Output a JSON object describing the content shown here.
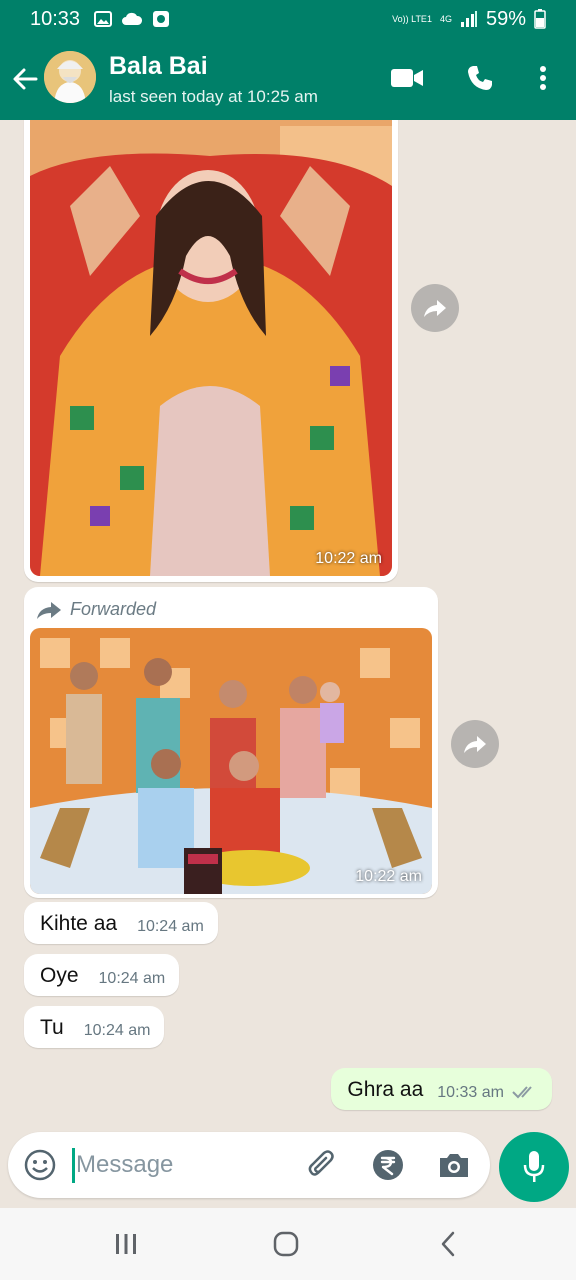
{
  "status_bar": {
    "time": "10:33",
    "network": "Vo)) LTE1",
    "network_type": "4G",
    "battery": "59%",
    "icons": [
      "image-icon",
      "cloud-icon",
      "app-icon",
      "signal-icon",
      "battery-icon"
    ]
  },
  "header": {
    "contact_name": "Bala Bai",
    "last_seen": "last seen today at 10:25 am",
    "icons": [
      "back-arrow-icon",
      "video-call-icon",
      "phone-icon",
      "more-options-icon"
    ]
  },
  "messages": [
    {
      "type": "image",
      "direction": "incoming",
      "time": "10:22 am",
      "forwarded": false
    },
    {
      "type": "image",
      "direction": "incoming",
      "time": "10:22 am",
      "forwarded": true,
      "forwarded_label": "Forwarded"
    },
    {
      "type": "text",
      "direction": "incoming",
      "text": "Kihte aa",
      "time": "10:24 am"
    },
    {
      "type": "text",
      "direction": "incoming",
      "text": "Oye",
      "time": "10:24 am"
    },
    {
      "type": "text",
      "direction": "incoming",
      "text": "Tu",
      "time": "10:24 am"
    },
    {
      "type": "text",
      "direction": "outgoing",
      "text": "Ghra aa",
      "time": "10:33 am",
      "status": "read"
    }
  ],
  "composer": {
    "placeholder": "Message",
    "icons": [
      "emoji-icon",
      "attach-icon",
      "rupee-payment-icon",
      "camera-icon",
      "mic-icon"
    ]
  },
  "colors": {
    "brand": "#008069",
    "accent": "#00a884",
    "chat_bg": "#ece5dd",
    "outgoing_bubble": "#e7ffdb"
  }
}
